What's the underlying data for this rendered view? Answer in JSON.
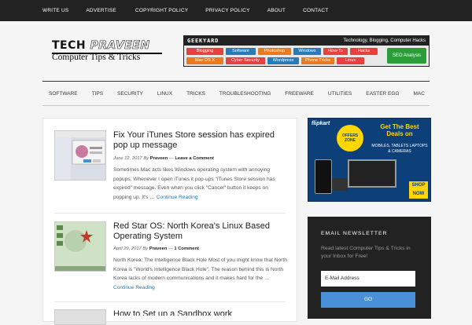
{
  "topnav": {
    "items": [
      "WRITE US",
      "ADVERTISE",
      "COPYRIGHT POLICY",
      "PRIVACY POLICY",
      "ABOUT",
      "CONTACT"
    ]
  },
  "logo": {
    "line1_a": "TECH ",
    "line1_b": "PRAVEEN",
    "line2": "Computer Tips & Tricks"
  },
  "banner": {
    "name": "GEEKYARD",
    "tagline": "Technology, Blogging, Computer Hacks",
    "tags": [
      {
        "label": "Blogging",
        "color": "#e84040"
      },
      {
        "label": "Software",
        "color": "#2a7ab5"
      },
      {
        "label": "Photoshop",
        "color": "#e87a20"
      },
      {
        "label": "Windows",
        "color": "#2a7ab5"
      },
      {
        "label": "How-To",
        "color": "#e84040"
      },
      {
        "label": "Hacks",
        "color": "#e84040"
      },
      {
        "label": "Mac OS X",
        "color": "#e87a20"
      },
      {
        "label": "Cyber Security",
        "color": "#e84040"
      },
      {
        "label": "Wordpress",
        "color": "#2a7ab5"
      },
      {
        "label": "Phone Tricks",
        "color": "#e87a20"
      },
      {
        "label": "Linux",
        "color": "#e84040"
      }
    ],
    "seo": "SEO Analysis"
  },
  "mainnav": {
    "items": [
      "SOFTWARE",
      "TIPS",
      "SECURITY",
      "LINUX",
      "TRICKS",
      "TROUBLESHOOTING",
      "FREEWARE",
      "UTILITIES",
      "EASTER EGG",
      "MAC"
    ]
  },
  "posts": [
    {
      "title": "Fix Your iTunes Store session has expired pop up message",
      "date": "June 12, 2017",
      "by": "By",
      "author": "Praveen",
      "comments": "Leave a Comment",
      "excerpt": "Sometimes Mac acts likes Windows operating system with annoying popups. Whenever I open iTunes it pop-ups \"iTunes Store session has expired\" message. Even when you click \"Cancel\" button it keeps on popping up. It's …",
      "more": "Continue Reading"
    },
    {
      "title": "Red Star OS: North Korea's Linux Based Operating System",
      "date": "April 29, 2017",
      "by": "By",
      "author": "Praveen",
      "comments": "1 Comment",
      "excerpt": "North Korea: The Intelligence Black Hole Most of you might know that North Korea is \"World's Intelligence Black Hole\". The reason behind this is North Korea lacks of modern communications and it makes hard for the …",
      "more": "Continue Reading"
    },
    {
      "title": "How to Set up a Sandbox work",
      "date": "",
      "by": "",
      "author": "",
      "comments": "",
      "excerpt": "",
      "more": ""
    }
  ],
  "ad": {
    "brand": "flipkart",
    "headline": "Get The Best Deals on",
    "subline": "MOBILES, TABLETS LAPTOPS & CAMERAS",
    "zone": "OFFERS ZONE",
    "shop": "SHOP NOW"
  },
  "newsletter": {
    "title": "EMAIL NEWSLETTER",
    "desc": "Read latest Computer Tips & Tricks in your Inbox for Free!",
    "placeholder": "E-Mail Address",
    "button": "GO"
  }
}
